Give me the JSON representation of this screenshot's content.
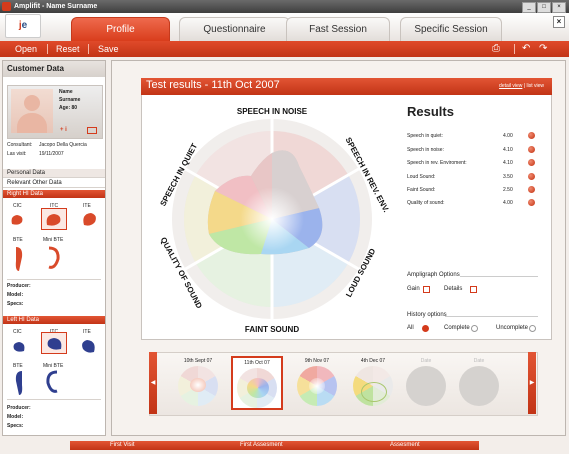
{
  "window": {
    "title": "Amplifit - Name Surname"
  },
  "header": {
    "logo_text": "je",
    "tabs": [
      {
        "label": "Profile",
        "active": true
      },
      {
        "label": "Questionnaire",
        "active": false
      },
      {
        "label": "Fast Session",
        "active": false
      },
      {
        "label": "Specific Session",
        "active": false
      }
    ]
  },
  "toolbar": {
    "open": "Open",
    "reset": "Reset",
    "save": "Save"
  },
  "customer": {
    "title": "Customer Data",
    "name_label": "Name",
    "surname_label": "Surname",
    "age_label": "Age: 80",
    "photo_actions": "+ i",
    "consultant_label": "Consultant:",
    "consultant_value": "Jacopo Della Quercia",
    "last_visit_label": "Las visit:",
    "last_visit_value": "19/11/2007",
    "menu": [
      "Personal Data",
      "Relevant Other Data"
    ],
    "right_hi": {
      "title": "Right HI Data",
      "devices": [
        "CIC",
        "ITC",
        "ITE",
        "BTE",
        "Mini BTE"
      ],
      "fields": [
        "Producer:",
        "Model:",
        "Specs:"
      ]
    },
    "left_hi": {
      "title": "Left HI Data",
      "devices": [
        "CIC",
        "ITC",
        "ITE",
        "BTE",
        "Mini BTE"
      ],
      "fields": [
        "Producer:",
        "Model:",
        "Specs:"
      ]
    }
  },
  "test": {
    "title": "Test results - 11th Oct 2007",
    "view_detail": "detail view",
    "view_list": "list view",
    "labels": {
      "top": "SPEECH IN NOISE",
      "top_right": "SPEECH IN REV. ENV.",
      "right": "LOUD SOUND",
      "bottom": "FAINT SOUND",
      "left": "QUALITY OF SOUND",
      "top_left": "SPEECH IN QUIET"
    },
    "results_title": "Results",
    "results": [
      {
        "label": "Speech in quiet:",
        "value": "4.00"
      },
      {
        "label": "Speech in noise:",
        "value": "4.10"
      },
      {
        "label": "Speech in rev. Enviroment:",
        "value": "4.10"
      },
      {
        "label": "Loud Sound:",
        "value": "3.50"
      },
      {
        "label": "Faint Sound:",
        "value": "2.50"
      },
      {
        "label": "Quality of sound:",
        "value": "4.00"
      }
    ],
    "ampligraph": {
      "title": "Ampligraph Options",
      "gain": "Gain",
      "details": "Details"
    },
    "history_opts": {
      "title": "History options",
      "all": "All",
      "complete": "Complete",
      "uncomplete": "Uncomplete"
    }
  },
  "history": [
    {
      "date": "10th Sept 07",
      "selected": false
    },
    {
      "date": "11th Oct 07",
      "selected": true
    },
    {
      "date": "9th Nov 07",
      "selected": false
    },
    {
      "date": "4th Dec 07",
      "selected": false
    },
    {
      "date": "Date",
      "selected": false
    },
    {
      "date": "Date",
      "selected": false
    }
  ],
  "bottom": [
    "First Visit",
    "First Assesment",
    "Assesment"
  ],
  "colors": {
    "accent": "#d43b1c",
    "accent_dark": "#c23416"
  }
}
